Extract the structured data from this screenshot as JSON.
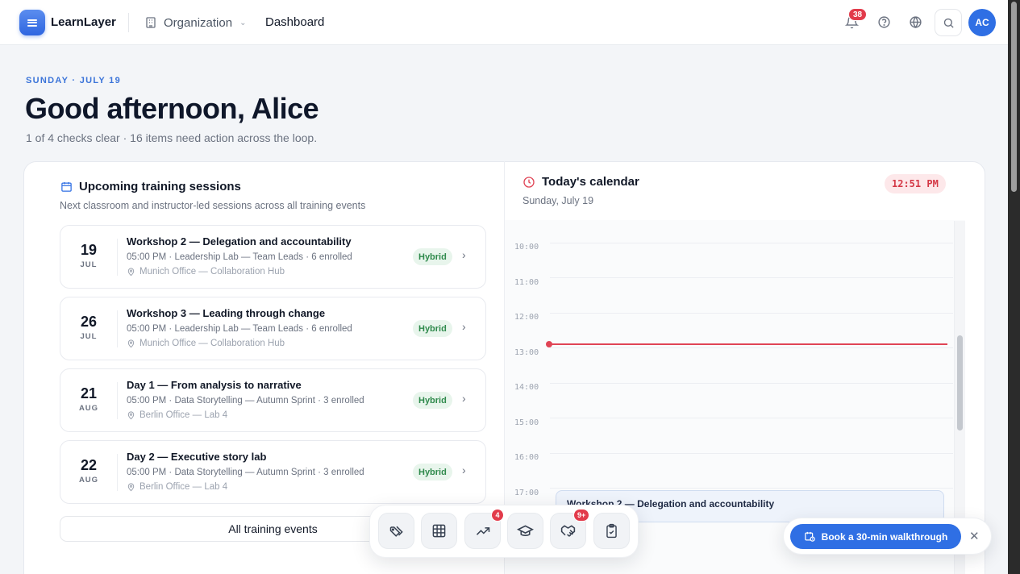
{
  "topbar": {
    "brand": "LearnLayer",
    "org_label": "Organization",
    "crumb": "Dashboard",
    "notifications_count": "38",
    "avatar_initials": "AC"
  },
  "greeting": {
    "eyebrow": "SUNDAY · JULY 19",
    "title": "Good afternoon, Alice",
    "subtitle": "1 of 4 checks clear · 16 items need action across the loop."
  },
  "sessions": {
    "title": "Upcoming training sessions",
    "subtitle": "Next classroom and instructor-led sessions across all training events",
    "items": [
      {
        "day": "19",
        "month": "JUL",
        "title": "Workshop 2 — Delegation and accountability",
        "meta": "05:00 PM · Leadership Lab — Team Leads · 6 enrolled",
        "location": "Munich Office — Collaboration Hub",
        "mode": "Hybrid"
      },
      {
        "day": "26",
        "month": "JUL",
        "title": "Workshop 3 — Leading through change",
        "meta": "05:00 PM · Leadership Lab — Team Leads · 6 enrolled",
        "location": "Munich Office — Collaboration Hub",
        "mode": "Hybrid"
      },
      {
        "day": "21",
        "month": "AUG",
        "title": "Day 1 — From analysis to narrative",
        "meta": "05:00 PM · Data Storytelling — Autumn Sprint · 3 enrolled",
        "location": "Berlin Office — Lab 4",
        "mode": "Hybrid"
      },
      {
        "day": "22",
        "month": "AUG",
        "title": "Day 2 — Executive story lab",
        "meta": "05:00 PM · Data Storytelling — Autumn Sprint · 3 enrolled",
        "location": "Berlin Office — Lab 4",
        "mode": "Hybrid"
      }
    ],
    "all_button": "All training events"
  },
  "calendar": {
    "title": "Today's calendar",
    "date": "Sunday, July 19",
    "current_time": "12:51 PM",
    "hours": [
      "10:00",
      "11:00",
      "12:00",
      "13:00",
      "14:00",
      "15:00",
      "16:00",
      "17:00"
    ],
    "event_title": "Workshop 2 — Delegation and accountability"
  },
  "dock": {
    "items": [
      {
        "icon": "tags-icon",
        "badge": ""
      },
      {
        "icon": "table-icon",
        "badge": ""
      },
      {
        "icon": "trending-up-icon",
        "badge": "4"
      },
      {
        "icon": "graduation-cap-icon",
        "badge": ""
      },
      {
        "icon": "handshake-icon",
        "badge": "9+"
      },
      {
        "icon": "clipboard-check-icon",
        "badge": ""
      }
    ]
  },
  "walkthrough": {
    "label": "Book a 30-min walkthrough",
    "close": "✕"
  },
  "colors": {
    "accent": "#2f6fe4",
    "danger": "#e23b4b",
    "success_bg": "#e8f5ec",
    "success_text": "#2f8a4c"
  }
}
